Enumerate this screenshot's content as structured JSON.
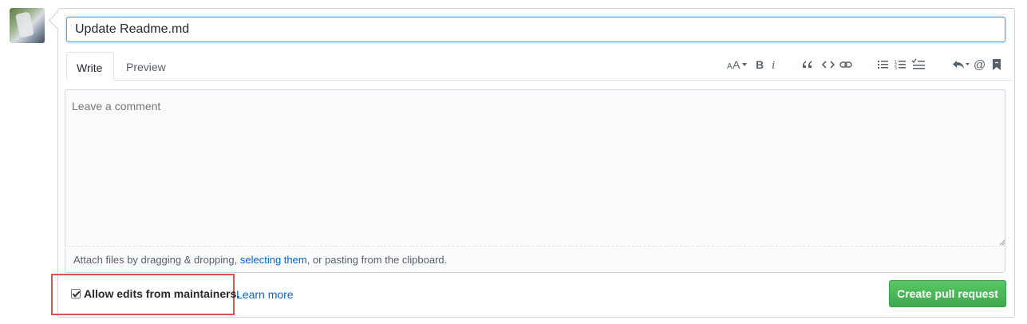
{
  "title_input": {
    "value": "Update Readme.md"
  },
  "tabs": [
    {
      "label": "Write",
      "active": true
    },
    {
      "label": "Preview",
      "active": false
    }
  ],
  "toolbar": {
    "icons": [
      "text-size-icon",
      "bold-icon",
      "italic-icon",
      "quote-icon",
      "code-icon",
      "link-icon",
      "bullet-list-icon",
      "numbered-list-icon",
      "task-list-icon",
      "reply-icon",
      "mention-icon",
      "bookmark-icon"
    ]
  },
  "comment": {
    "placeholder": "Leave a comment",
    "attach_prefix": "Attach files by dragging & dropping, ",
    "attach_link": "selecting them",
    "attach_suffix": ", or pasting from the clipboard."
  },
  "footer": {
    "allow_edits_label": "Allow edits from maintainers.",
    "allow_edits_checked": true,
    "learn_more": "Learn more",
    "create_button": "Create pull request"
  },
  "colors": {
    "accent_blue": "#0366d6",
    "button_green": "#3fa94d",
    "highlight_red": "#d9534f"
  }
}
